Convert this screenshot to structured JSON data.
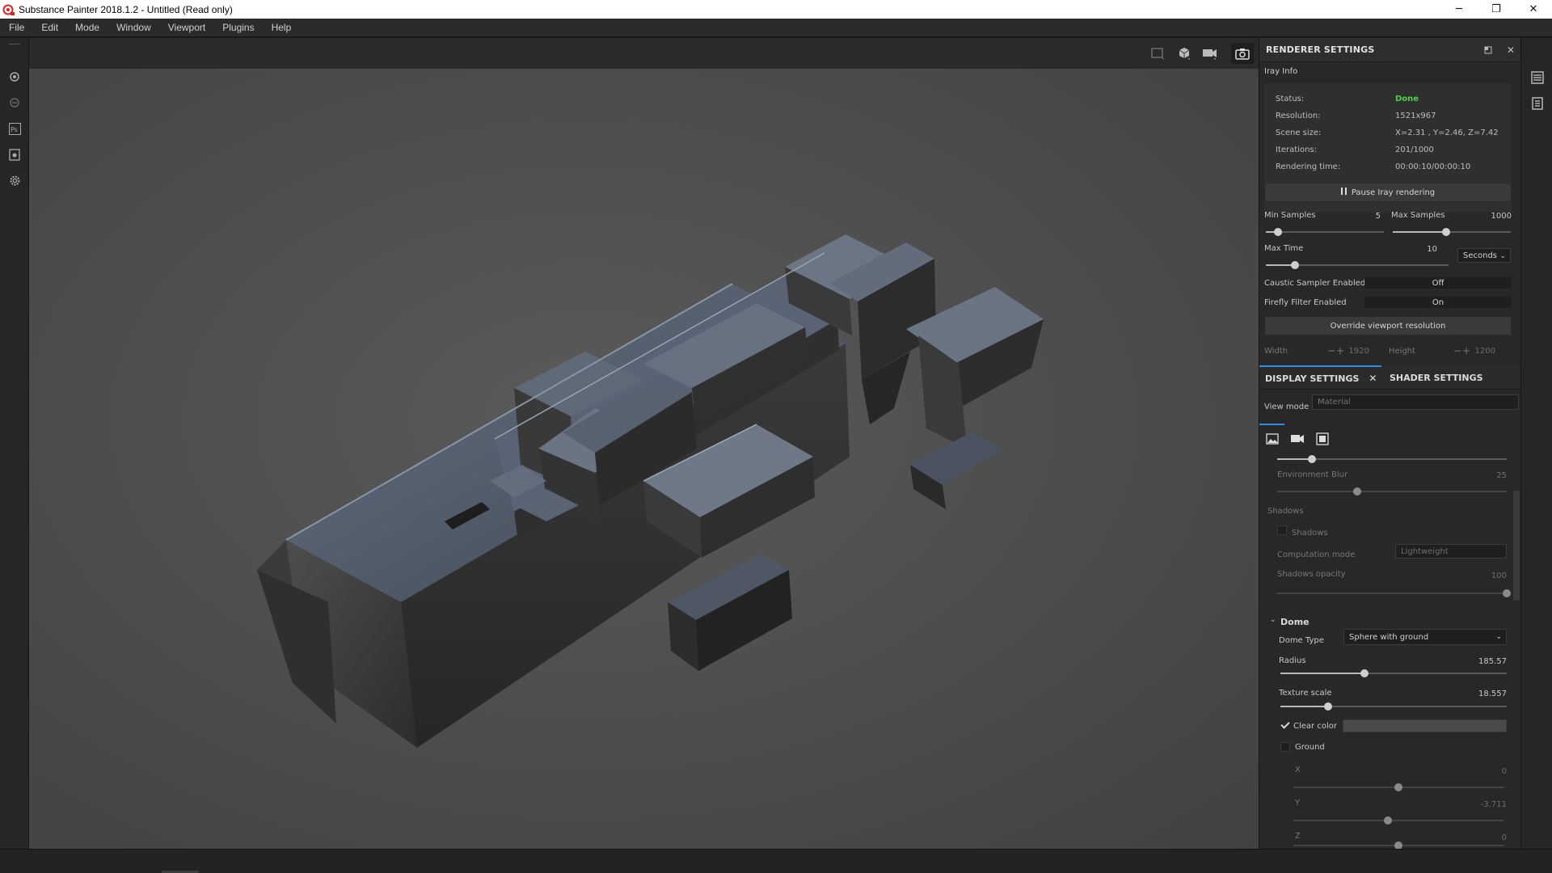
{
  "window": {
    "title": "Substance Painter 2018.1.2 - Untitled (Read only)",
    "minimize": "─",
    "maximize": "❐",
    "close": "✕"
  },
  "menu": [
    "File",
    "Edit",
    "Mode",
    "Window",
    "Viewport",
    "Plugins",
    "Help"
  ],
  "renderer": {
    "title": "RENDERER SETTINGS",
    "section": "Iray Info",
    "info": [
      {
        "key": "Status:",
        "value": "Done"
      },
      {
        "key": "Resolution:",
        "value": "1521x967"
      },
      {
        "key": "Scene size:",
        "value": "X=2.31 , Y=2.46, Z=7.42"
      },
      {
        "key": "Iterations:",
        "value": "201/1000"
      },
      {
        "key": "Rendering time:",
        "value": "00:00:10/00:00:10"
      }
    ],
    "pause_button": "Pause Iray rendering",
    "min_samples": {
      "label": "Min Samples",
      "value": "5",
      "fraction": 0.1
    },
    "max_samples": {
      "label": "Max Samples",
      "value": "1000",
      "fraction": 0.45
    },
    "max_time": {
      "label": "Max Time",
      "value": "10",
      "fraction": 0.16,
      "unit": "Seconds"
    },
    "caustic": {
      "label": "Caustic Sampler Enabled",
      "value": "Off"
    },
    "firefly": {
      "label": "Firefly Filter Enabled",
      "value": "On"
    },
    "override_button": "Override viewport resolution",
    "width": {
      "label": "Width",
      "value": "1920"
    },
    "height": {
      "label": "Height",
      "value": "1200"
    }
  },
  "tabs": {
    "display": "DISPLAY SETTINGS",
    "shader": "SHADER SETTINGS"
  },
  "display": {
    "view_mode_label": "View mode",
    "view_mode_value": "Material",
    "top_slider_fraction": 0.15,
    "environment_blur": {
      "label": "Environment Blur",
      "value": "25",
      "fraction": 0.35
    },
    "shadows_section": "Shadows",
    "shadows_checkbox": "Shadows",
    "computation_mode": {
      "label": "Computation mode",
      "value": "Lightweight"
    },
    "shadows_opacity": {
      "label": "Shadows opacity",
      "value": "100",
      "fraction": 1.0
    },
    "dome": {
      "title": "Dome",
      "type_label": "Dome Type",
      "type_value": "Sphere with ground",
      "radius": {
        "label": "Radius",
        "value": "185.57",
        "fraction": 0.37
      },
      "texture_scale": {
        "label": "Texture scale",
        "value": "18.557",
        "fraction": 0.21
      },
      "clear_color": "Clear color",
      "ground": "Ground",
      "x": {
        "label": "X",
        "value": "0",
        "fraction": 0.5
      },
      "y": {
        "label": "Y",
        "value": "-3.711",
        "fraction": 0.45
      },
      "z": {
        "label": "Z",
        "value": "0",
        "fraction": 0.5
      }
    }
  }
}
